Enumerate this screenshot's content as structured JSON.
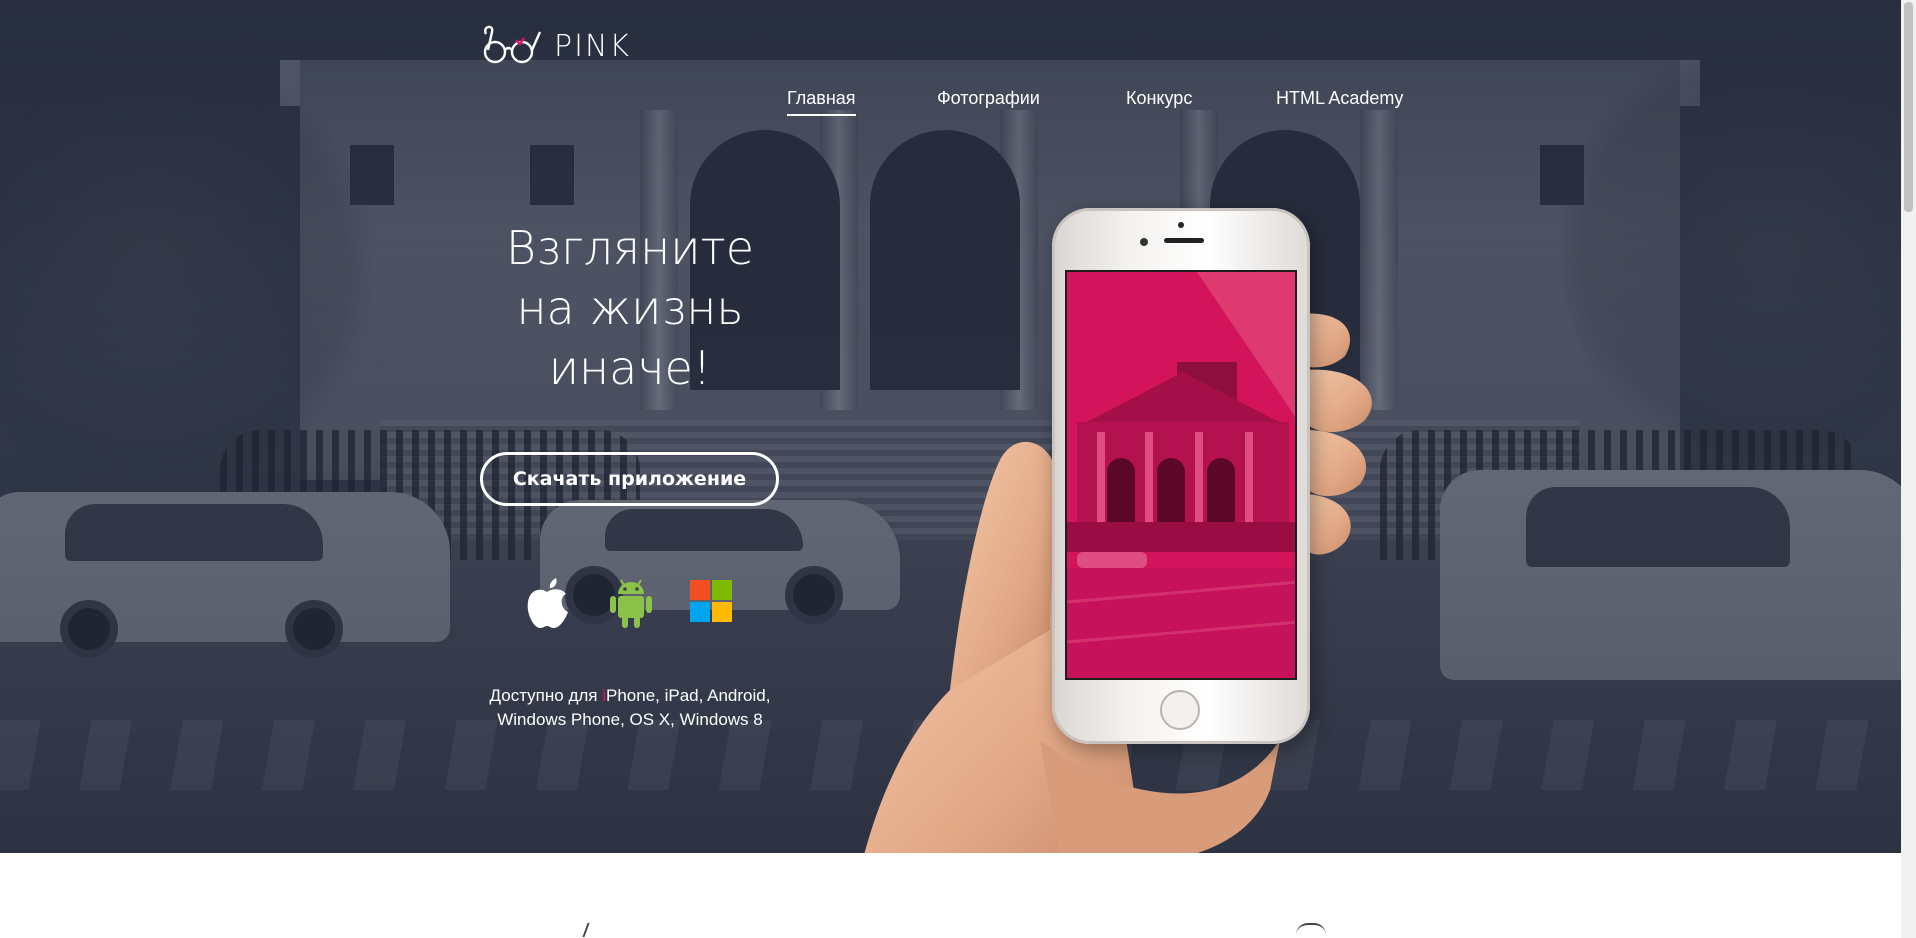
{
  "header": {
    "logo_text": "PINK",
    "nav": [
      {
        "label": "Главная",
        "active": true
      },
      {
        "label": "Фотографии",
        "active": false
      },
      {
        "label": "Конкурс",
        "active": false
      },
      {
        "label": "HTML Academy",
        "active": false
      }
    ]
  },
  "hero": {
    "headline": [
      "Взгляните",
      "на жизнь",
      "иначе!"
    ],
    "cta_label": "Скачать приложение",
    "platform_icons": [
      "apple-icon",
      "android-icon",
      "windows-icon"
    ],
    "availability_prefix": "Доступно для ",
    "availability_accent": "i",
    "availability_rest_line1": "Phone, iPad, Android,",
    "availability_line2": "Windows Phone, OS X, Windows 8"
  },
  "colors": {
    "accent": "#e3106a",
    "hero_overlay": "#2a3142",
    "phone_screen": "#d4145a",
    "text_on_dark": "#ffffff"
  }
}
